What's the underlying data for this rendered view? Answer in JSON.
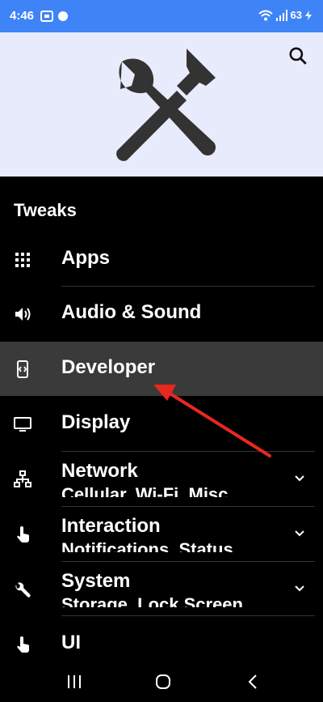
{
  "status": {
    "time": "4:46",
    "battery": "63"
  },
  "section_title": "Tweaks",
  "items": [
    {
      "label": "Apps",
      "icon": "apps-grid-icon"
    },
    {
      "label": "Audio & Sound",
      "icon": "speaker-icon"
    },
    {
      "label": "Developer",
      "icon": "developer-mode-icon",
      "selected": true
    },
    {
      "label": "Display",
      "icon": "monitor-icon"
    },
    {
      "label": "Network",
      "subtitle": "Cellular, Wi-Fi, Misc",
      "icon": "network-icon",
      "expandable": true
    },
    {
      "label": "Interaction",
      "subtitle": "Notifications, Status",
      "icon": "touch-icon",
      "expandable": true
    },
    {
      "label": "System",
      "subtitle": "Storage, Lock Screen",
      "icon": "wrench-icon",
      "expandable": true
    },
    {
      "label": "UI",
      "icon": "touch-icon"
    }
  ],
  "colors": {
    "status_bar": "#3f84f7",
    "header_bg": "#e8ebfb",
    "selected_bg": "#3a3a3a",
    "annotation_arrow": "#e8281e"
  }
}
